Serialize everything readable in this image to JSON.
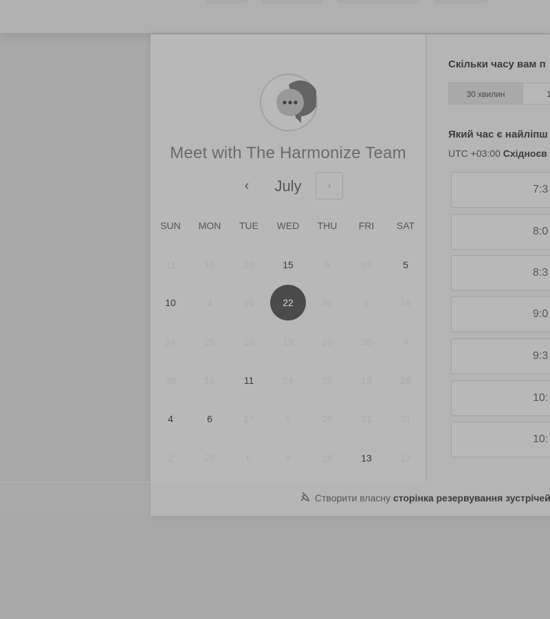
{
  "modal": {
    "title": "Meet with The Harmonize Team",
    "month_nav": {
      "prev_icon": "‹",
      "month": "July",
      "next_icon": "›"
    },
    "weekdays": [
      "SUN",
      "MON",
      "TUE",
      "WED",
      "THU",
      "FRI",
      "SAT"
    ],
    "days": [
      [
        {
          "t": "11",
          "s": "muted"
        },
        {
          "t": "10",
          "s": "muted"
        },
        {
          "t": "20",
          "s": "muted"
        },
        {
          "t": "15",
          "s": "active"
        },
        {
          "t": "5",
          "s": "muted"
        },
        {
          "t": "19",
          "s": "muted"
        },
        {
          "t": "5",
          "s": "active"
        }
      ],
      [
        {
          "t": "10",
          "s": "active"
        },
        {
          "t": "4",
          "s": "muted"
        },
        {
          "t": "26",
          "s": "muted"
        },
        {
          "t": "22",
          "s": "selected"
        },
        {
          "t": "30",
          "s": "muted"
        },
        {
          "t": "5",
          "s": "muted"
        },
        {
          "t": "16",
          "s": "muted"
        }
      ],
      [
        {
          "t": "24",
          "s": "muted"
        },
        {
          "t": "26",
          "s": "muted"
        },
        {
          "t": "10",
          "s": "muted"
        },
        {
          "t": "13",
          "s": "muted"
        },
        {
          "t": "10",
          "s": "muted"
        },
        {
          "t": "28",
          "s": "muted"
        },
        {
          "t": "4",
          "s": "muted"
        }
      ],
      [
        {
          "t": "28",
          "s": "muted"
        },
        {
          "t": "18",
          "s": "muted"
        },
        {
          "t": "11",
          "s": "active"
        },
        {
          "t": "24",
          "s": "muted"
        },
        {
          "t": "29",
          "s": "muted"
        },
        {
          "t": "13",
          "s": "muted"
        },
        {
          "t": "29",
          "s": "muted"
        }
      ],
      [
        {
          "t": "4",
          "s": "active"
        },
        {
          "t": "6",
          "s": "active"
        },
        {
          "t": "17",
          "s": "muted"
        },
        {
          "t": "5",
          "s": "muted"
        },
        {
          "t": "26",
          "s": "muted"
        },
        {
          "t": "31",
          "s": "muted"
        },
        {
          "t": "31",
          "s": "muted"
        }
      ],
      [
        {
          "t": "2",
          "s": "muted"
        },
        {
          "t": "28",
          "s": "muted"
        },
        {
          "t": "6",
          "s": "muted"
        },
        {
          "t": "9",
          "s": "muted"
        },
        {
          "t": "18",
          "s": "muted"
        },
        {
          "t": "13",
          "s": "active"
        },
        {
          "t": "13",
          "s": "muted"
        }
      ]
    ],
    "right": {
      "question_duration": "Скільки часу вам п",
      "durations": [
        "30 хвилин",
        "1"
      ],
      "question_time": "Який час є найліпш",
      "timezone_offset": "UTC +03:00",
      "timezone_name": "Східноєв",
      "slots": [
        "7:3",
        "8:0",
        "8:3",
        "9:0",
        "9:3",
        "10:",
        "10:"
      ]
    },
    "footer": {
      "icon": "pin-icon",
      "text": "Створити власну",
      "link": "сторінка резервування зустрічей"
    }
  }
}
